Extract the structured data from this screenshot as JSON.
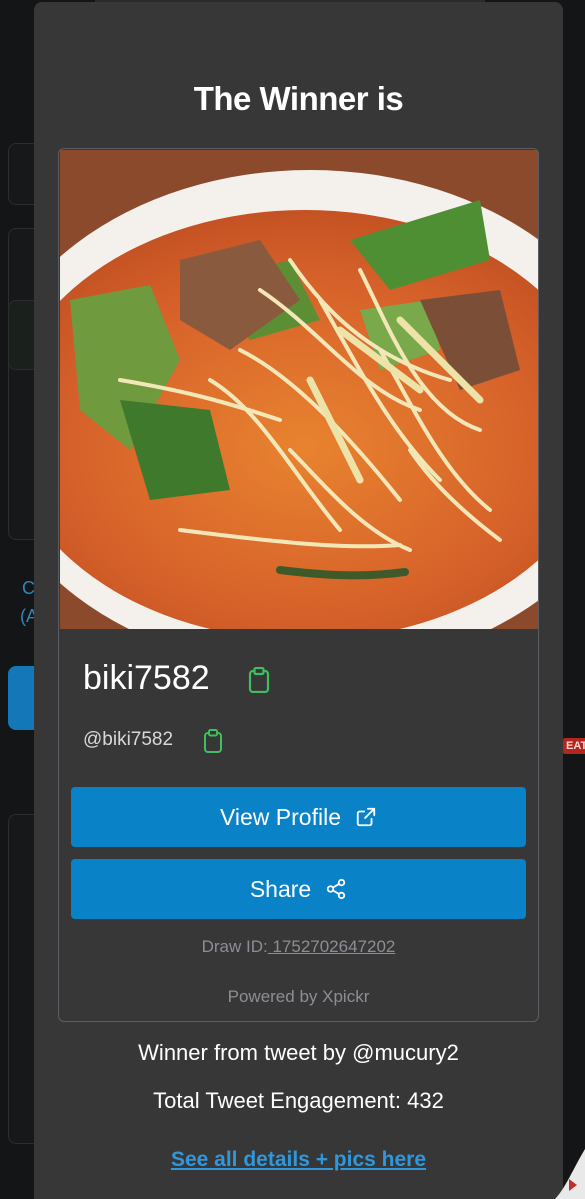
{
  "modal": {
    "title": "The Winner is",
    "winner": {
      "display_name": "biki7582",
      "handle": "@biki7582",
      "photo_icon": "food-photo"
    },
    "buttons": {
      "view_profile": "View Profile",
      "share": "Share"
    },
    "draw": {
      "label": "Draw ID:",
      "id": " 1752702647202"
    },
    "powered_by": "Powered by Xpickr",
    "tweet_source": "Winner from tweet by @mucury2",
    "engagement": "Total Tweet Engagement: 432",
    "details_link": "See all details + pics here"
  },
  "background": {
    "partial_text_1": "C",
    "partial_text_2": "(A",
    "badge": "EAT"
  },
  "colors": {
    "modal_bg": "#373737",
    "button_blue": "#0a82c8",
    "link_blue": "#2f97dc",
    "copy_icon_green": "#3fbf5f",
    "muted_text": "#8b8e95"
  }
}
